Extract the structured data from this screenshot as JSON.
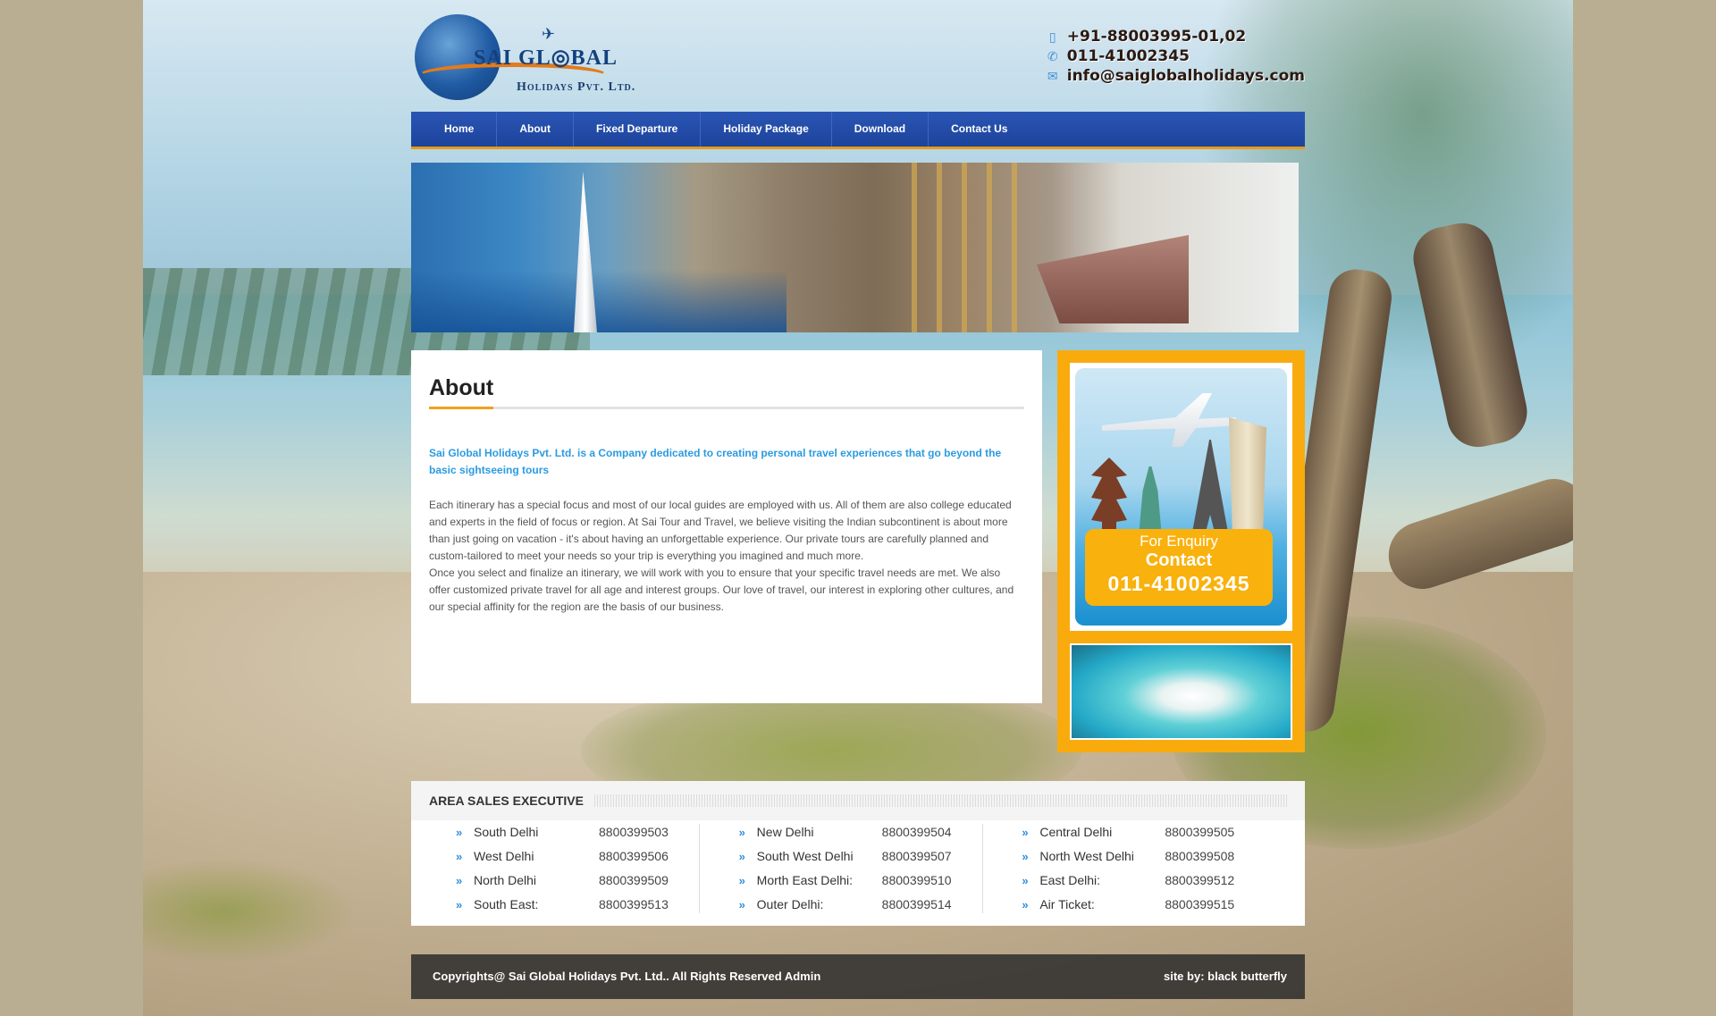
{
  "logo": {
    "name": "SAI GL◎BAL",
    "subtitle": "Holidays Pvt. Ltd."
  },
  "contacts": [
    {
      "icon": "mobile-icon",
      "text": "+91-88003995-01,02"
    },
    {
      "icon": "phone-icon",
      "text": "011-41002345"
    },
    {
      "icon": "email-icon",
      "text": "info@saiglobalholidays.com"
    }
  ],
  "nav": [
    "Home",
    "About",
    "Fixed Departure",
    "Holiday Package",
    "Download",
    "Contact Us"
  ],
  "about": {
    "title": "About",
    "lead": "Sai Global Holidays Pvt. Ltd. is a Company dedicated to creating personal travel experiences that go beyond the basic sightseeing tours",
    "para1": "Each itinerary has a special focus and most of our local guides are employed with us. All of them are also college educated and experts in the field of focus or region. At Sai Tour and Travel, we believe visiting the Indian subcontinent is about more than just going on vacation - it's about having an unforgettable experience. Our private tours are carefully planned and custom-tailored to meet your needs so your trip is everything you imagined and much more.",
    "para2": "Once you select and finalize an itinerary, we will work with you to ensure that your specific travel needs are met. We also offer customized private travel for all age and interest groups. Our love of travel, our interest in exploring other cultures, and our special affinity for the region are the basis of our business."
  },
  "enquiry": {
    "line1": "For Enquiry",
    "line2": "Contact",
    "phone": "011-41002345"
  },
  "sales": {
    "title": "AREA SALES EXECUTIVE",
    "columns": [
      [
        {
          "area": "South Delhi",
          "number": "8800399503"
        },
        {
          "area": "West Delhi",
          "number": "8800399506"
        },
        {
          "area": "North Delhi",
          "number": "8800399509"
        },
        {
          "area": "South East:",
          "number": "8800399513"
        }
      ],
      [
        {
          "area": "New Delhi",
          "number": "8800399504"
        },
        {
          "area": "South West Delhi",
          "number": "8800399507"
        },
        {
          "area": "Morth East Delhi:",
          "number": "8800399510"
        },
        {
          "area": "Outer Delhi:",
          "number": "8800399514"
        }
      ],
      [
        {
          "area": "Central Delhi",
          "number": "8800399505"
        },
        {
          "area": "North West Delhi",
          "number": "8800399508"
        },
        {
          "area": "East Delhi:",
          "number": "8800399512"
        },
        {
          "area": "Air Ticket:",
          "number": "8800399515"
        }
      ]
    ]
  },
  "footer": {
    "copyright": "Copyrights@ Sai Global Holidays Pvt. Ltd.. All Rights Reserved Admin",
    "credit": "site by: black butterfly"
  },
  "colors": {
    "nav": "#1d449c",
    "accent": "#f9ab0e",
    "lead": "#2b9be0"
  }
}
